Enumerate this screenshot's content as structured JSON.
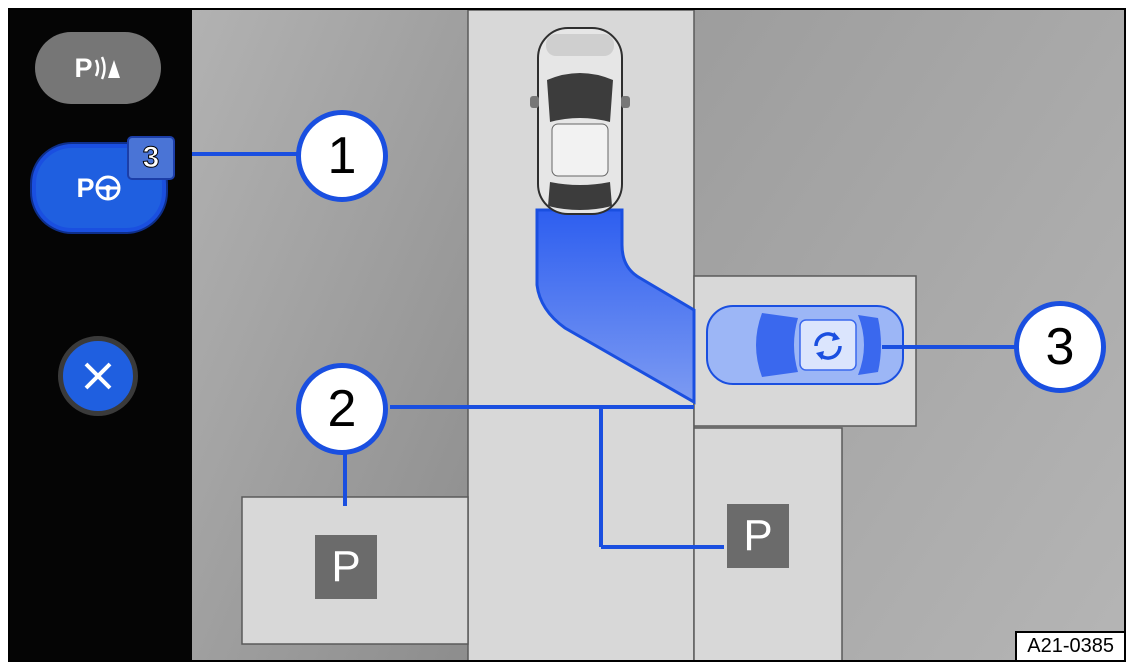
{
  "sidebar": {
    "park_assist_button": {
      "label": "P",
      "icon": "parking-sensor-icon"
    },
    "park_steer_button": {
      "label": "P",
      "icon": "steering-wheel-icon",
      "badge": "3"
    },
    "close_button": {
      "icon": "close-icon"
    }
  },
  "parking_signs": [
    "P",
    "P"
  ],
  "vehicles": {
    "own_car": {
      "icon": "car-top-view-icon"
    },
    "target_car": {
      "icon": "refresh-icon"
    }
  },
  "callouts": [
    "1",
    "2",
    "3"
  ],
  "image_id": "A21-0385",
  "colors": {
    "accent": "#1a4fe0",
    "sidebar": "#050505",
    "road": "#d8d8d8",
    "ground": "#9b9b9b"
  }
}
